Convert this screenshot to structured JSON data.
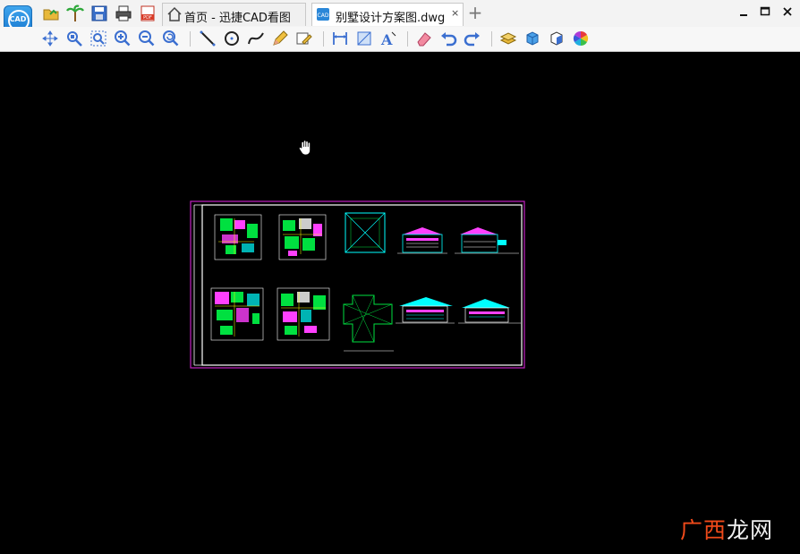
{
  "app": {
    "logo_text": "CAD"
  },
  "tabs": [
    {
      "label": "首页 - 迅捷CAD看图",
      "icon": "home-icon"
    },
    {
      "label": "别墅设计方案图.dwg",
      "icon": "dwg-file-icon",
      "close": "×"
    }
  ],
  "new_tab_symbol": "+",
  "window_controls": {
    "minimize": "_",
    "maximize": "□",
    "close": "×"
  },
  "quick_access": [
    "open-folder-icon",
    "palm-tree-icon",
    "save-icon",
    "print-icon",
    "pdf-export-icon"
  ],
  "toolbar_icons": [
    "pan-icon",
    "zoom-window-icon",
    "zoom-extents-icon",
    "zoom-in-icon",
    "zoom-out-icon",
    "zoom-previous-icon",
    "line-icon",
    "circle-icon",
    "spline-icon",
    "pencil-icon",
    "text-edit-icon",
    "dimension-icon",
    "area-measure-icon",
    "text-style-icon",
    "eraser-icon",
    "undo-icon",
    "redo-icon",
    "layers-icon",
    "block-3d-icon",
    "view-cube-icon",
    "color-wheel-icon"
  ],
  "watermark": {
    "part1": "广西",
    "part2": "龙网"
  },
  "colors": {
    "canvas": "#000000",
    "frame": "#c020c0",
    "sheet_border": "#ffffff",
    "magenta": "#ff00ff",
    "green": "#00ff00",
    "cyan": "#00ffff"
  }
}
